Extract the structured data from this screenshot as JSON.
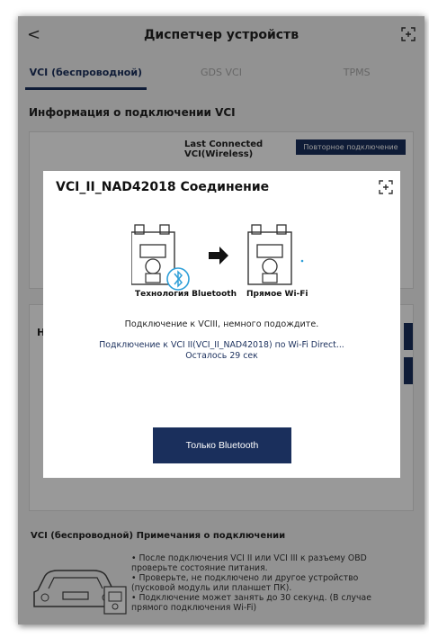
{
  "header": {
    "title": "Диспетчер устройств",
    "back_glyph": "<"
  },
  "tabs": [
    {
      "label": "VCI (беспроводной)",
      "active": true
    },
    {
      "label": "GDS VCI",
      "active": false
    },
    {
      "label": "TPMS",
      "active": false
    }
  ],
  "connection_info": {
    "title": "Информация о подключении VCI",
    "last_connected_line1": "Last Connected",
    "last_connected_line2": "VCI(Wireless)",
    "reconnect_label": "Повторное подключение"
  },
  "list_card": {
    "stub_letter": "Н"
  },
  "notes": {
    "title": "VCI (беспроводной) Примечания о подключении",
    "lines": [
      "• После подключения VCI II или VCI III к разъему OBD",
      "проверьте состояние питания.",
      "• Проверьте, не подключено ли другое устройство",
      "(пусковой модуль или планшет ПК).",
      "• Подключение может занять до 30 секунд. (В случае",
      "прямого подключения Wi-Fi)"
    ]
  },
  "dialog": {
    "title": "VCI_II_NAD42018 Соединение",
    "caption_bluetooth": "Технология Bluetooth",
    "caption_wifi": "Прямое Wi-Fi",
    "message": "Подключение к VCIII, немного подождите.",
    "status": "Подключение к VCI II(VCI_II_NAD42018) по Wi-Fi Direct...",
    "remaining": "Осталось 29 сек",
    "button_label": "Только Bluetooth"
  },
  "colors": {
    "accent": "#1a2f5c",
    "bluetooth": "#2e9fd8"
  },
  "icons": [
    "back-arrow-icon",
    "expand-icon",
    "vci-device-icon",
    "bluetooth-icon",
    "arrow-right-icon",
    "wifi-icon",
    "car-icon"
  ]
}
